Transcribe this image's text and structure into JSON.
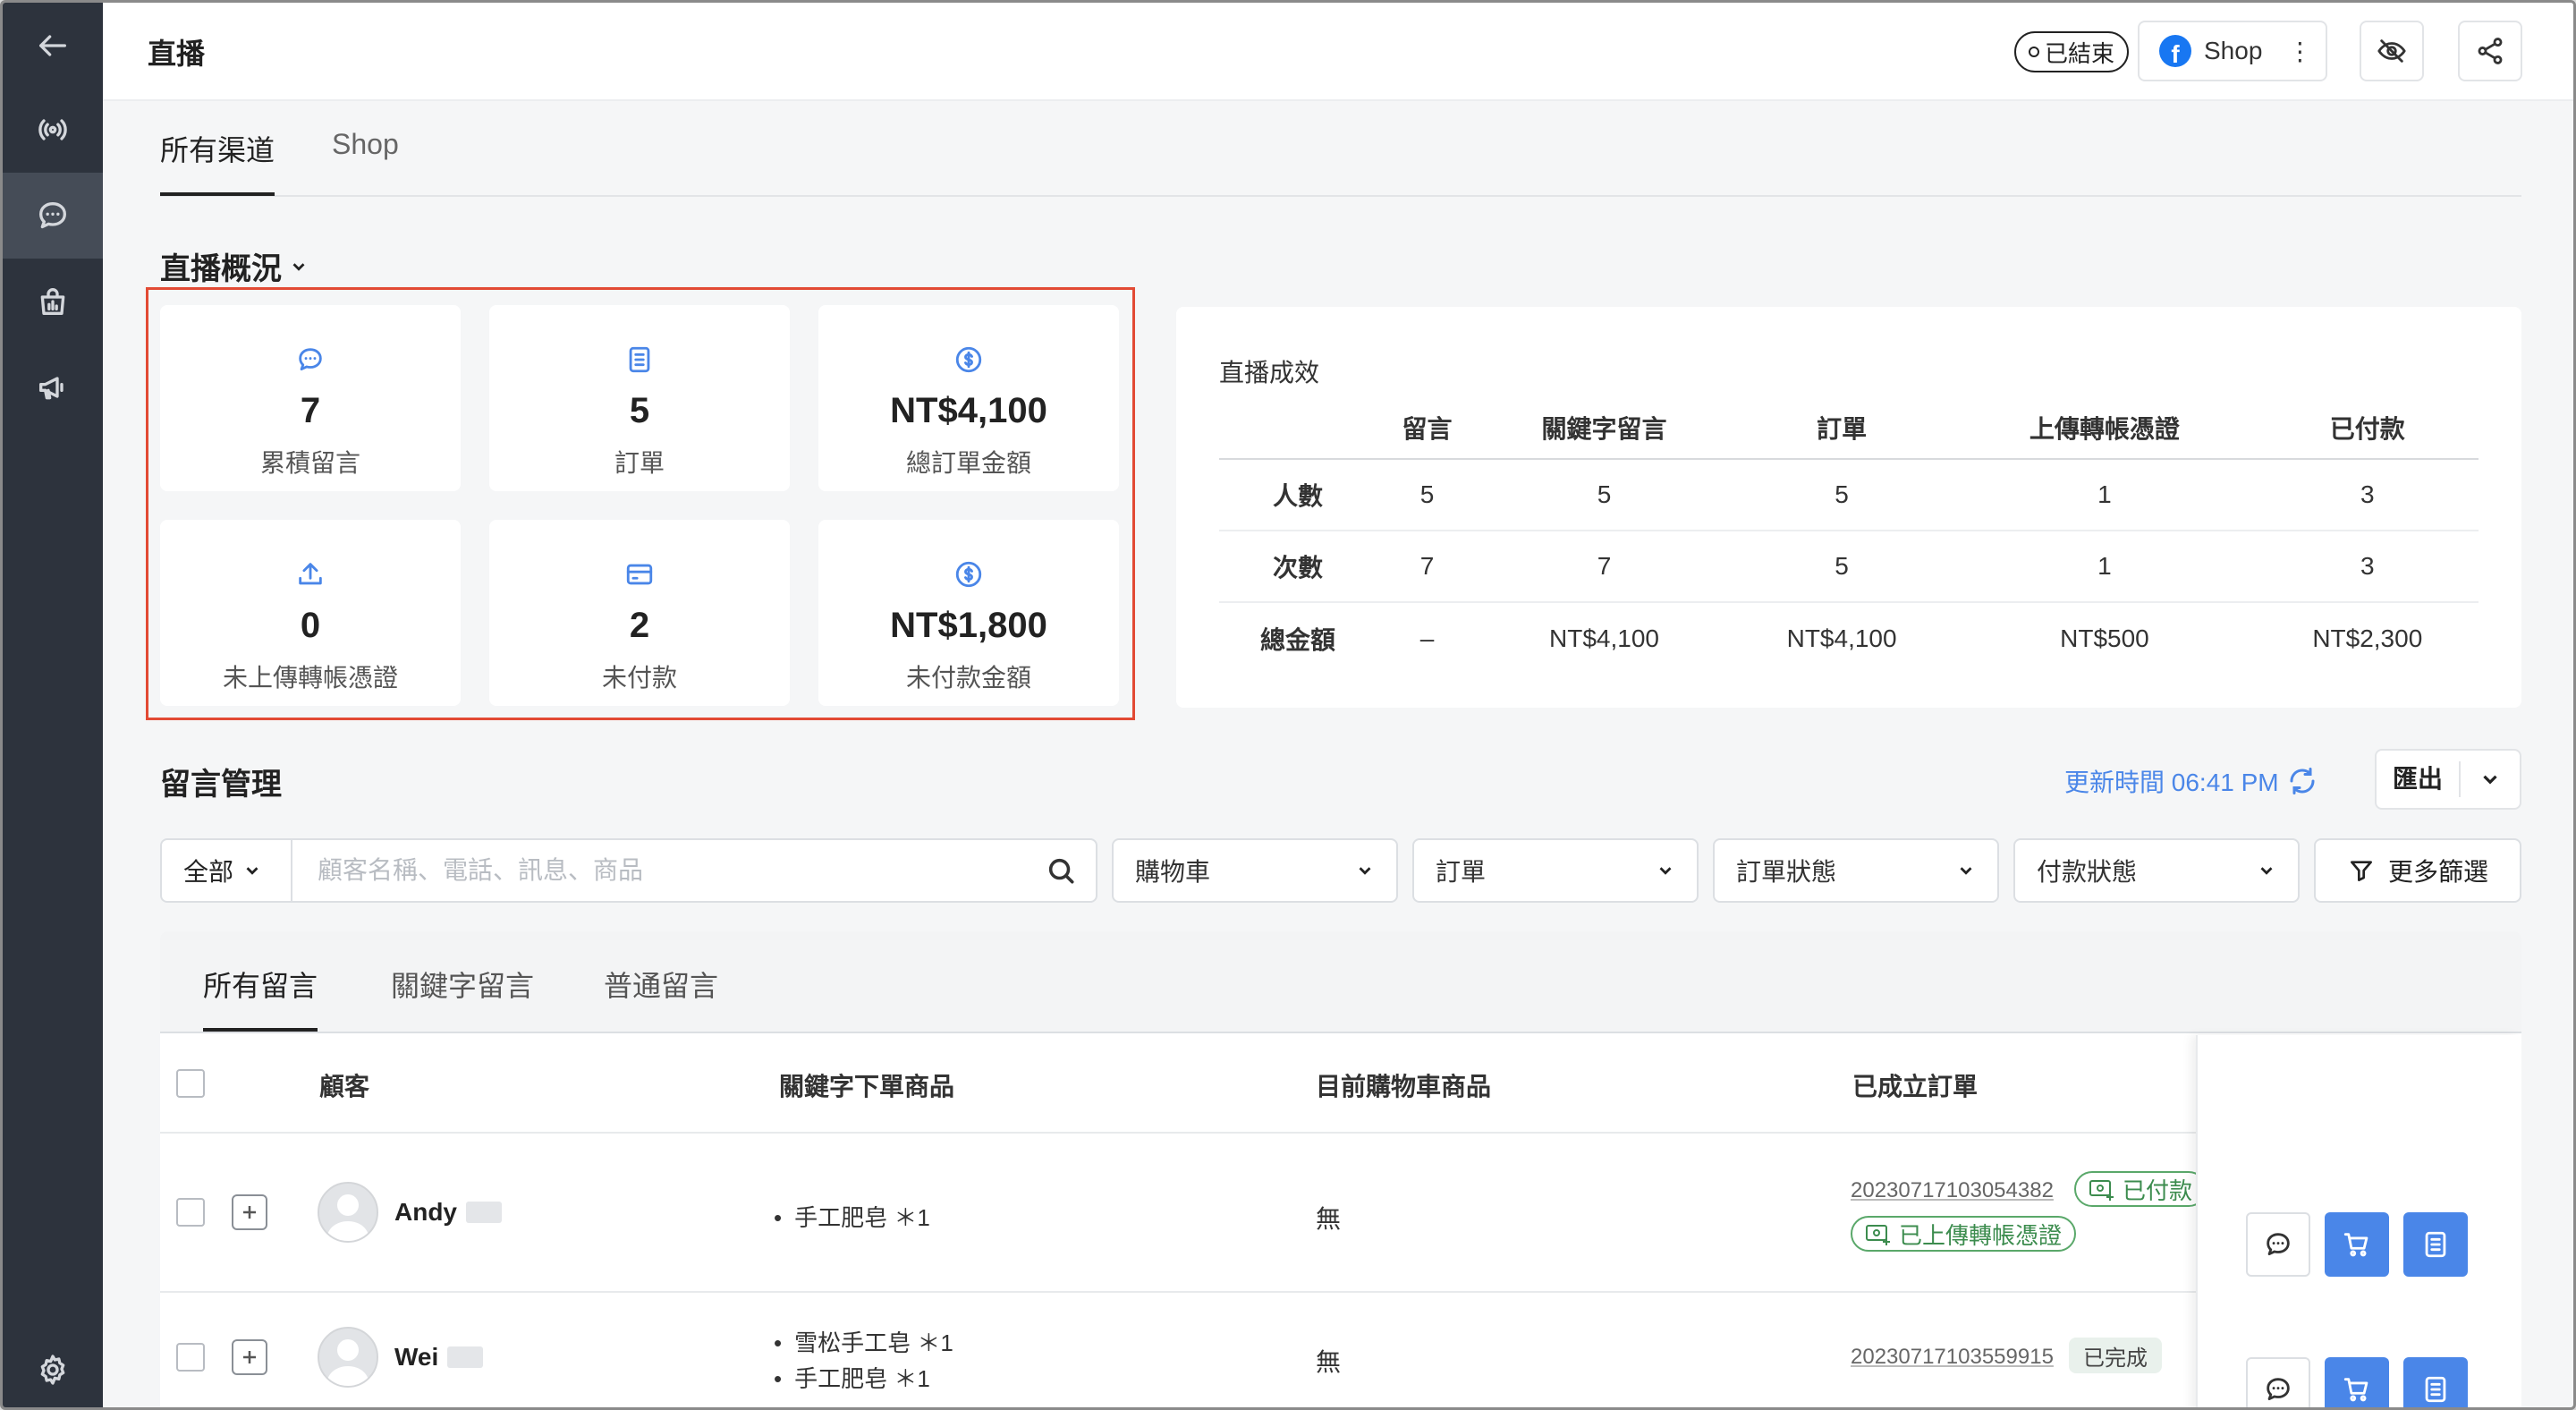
{
  "header": {
    "title": "直播",
    "status": "已結束",
    "channel_button": "Shop"
  },
  "channel_tabs": [
    "所有渠道",
    "Shop"
  ],
  "overview": {
    "title": "直播概況",
    "stats": [
      {
        "icon": "chat-bubble-icon",
        "value": "7",
        "label": "累積留言"
      },
      {
        "icon": "clipboard-icon",
        "value": "5",
        "label": "訂單"
      },
      {
        "icon": "dollar-coin-icon",
        "value": "NT$4,100",
        "label": "總訂單金額"
      },
      {
        "icon": "upload-icon",
        "value": "0",
        "label": "未上傳轉帳憑證"
      },
      {
        "icon": "credit-card-icon",
        "value": "2",
        "label": "未付款"
      },
      {
        "icon": "dollar-coin-icon",
        "value": "NT$1,800",
        "label": "未付款金額"
      }
    ]
  },
  "performance": {
    "title": "直播成效",
    "columns": [
      "留言",
      "關鍵字留言",
      "訂單",
      "上傳轉帳憑證",
      "已付款"
    ],
    "rows": [
      {
        "label": "人數",
        "cells": [
          "5",
          "5",
          "5",
          "1",
          "3"
        ]
      },
      {
        "label": "次數",
        "cells": [
          "7",
          "7",
          "5",
          "1",
          "3"
        ]
      },
      {
        "label": "總金額",
        "cells": [
          "–",
          "NT$4,100",
          "NT$4,100",
          "NT$500",
          "NT$2,300"
        ]
      }
    ]
  },
  "comments": {
    "title": "留言管理",
    "update_time": "更新時間 06:41 PM",
    "export_label": "匯出",
    "scope": "全部",
    "search_placeholder": "顧客名稱、電話、訊息、商品",
    "filters": [
      "購物車",
      "訂單",
      "訂單狀態",
      "付款狀態"
    ],
    "more_filters": "更多篩選",
    "tabs": [
      "所有留言",
      "關鍵字留言",
      "普通留言"
    ],
    "columns": {
      "customer": "顧客",
      "keyword_items": "關鍵字下單商品",
      "cart_items": "目前購物車商品",
      "orders": "已成立訂單"
    },
    "rows": [
      {
        "name": "Andy",
        "items": [
          "手工肥皂 ＊1"
        ],
        "cart": "無",
        "order_no": "20230717103054382",
        "tags": [
          "已付款",
          "已上傳轉帳憑證"
        ]
      },
      {
        "name": "Wei",
        "items": [
          "雪松手工皂 ＊1",
          "手工肥皂 ＊1"
        ],
        "cart": "無",
        "order_no": "20230717103559915",
        "tags": [
          "已完成"
        ]
      }
    ]
  }
}
